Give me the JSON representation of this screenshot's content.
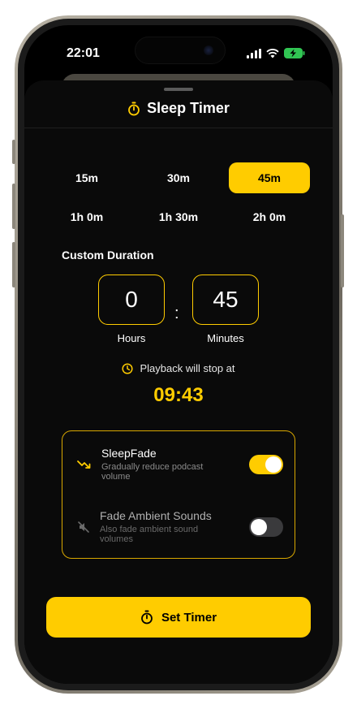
{
  "status_bar": {
    "time": "22:01",
    "icons": [
      "signal-icon",
      "wifi-icon",
      "battery-charging-icon"
    ]
  },
  "sheet": {
    "title": "Sleep Timer",
    "title_icon": "stopwatch-icon"
  },
  "presets": [
    {
      "label": "15m",
      "selected": false
    },
    {
      "label": "30m",
      "selected": false
    },
    {
      "label": "45m",
      "selected": true
    },
    {
      "label": "1h 0m",
      "selected": false
    },
    {
      "label": "1h 30m",
      "selected": false
    },
    {
      "label": "2h 0m",
      "selected": false
    }
  ],
  "custom": {
    "label": "Custom Duration",
    "hours_value": "0",
    "minutes_value": "45",
    "separator": ":",
    "hours_label": "Hours",
    "minutes_label": "Minutes"
  },
  "stop_info": {
    "text": "Playback will stop at",
    "time": "09:43",
    "icon": "clock-icon"
  },
  "options": {
    "sleepfade": {
      "title": "SleepFade",
      "subtitle": "Gradually reduce podcast volume",
      "enabled": true,
      "icon": "trend-down-icon"
    },
    "ambient": {
      "title": "Fade Ambient Sounds",
      "subtitle": "Also fade ambient sound volumes",
      "enabled": false,
      "icon": "speaker-muted-icon"
    }
  },
  "action": {
    "label": "Set Timer",
    "icon": "stopwatch-icon"
  },
  "colors": {
    "accent": "#ffcc00",
    "background": "#0a0a0a",
    "text": "#ffffff"
  }
}
